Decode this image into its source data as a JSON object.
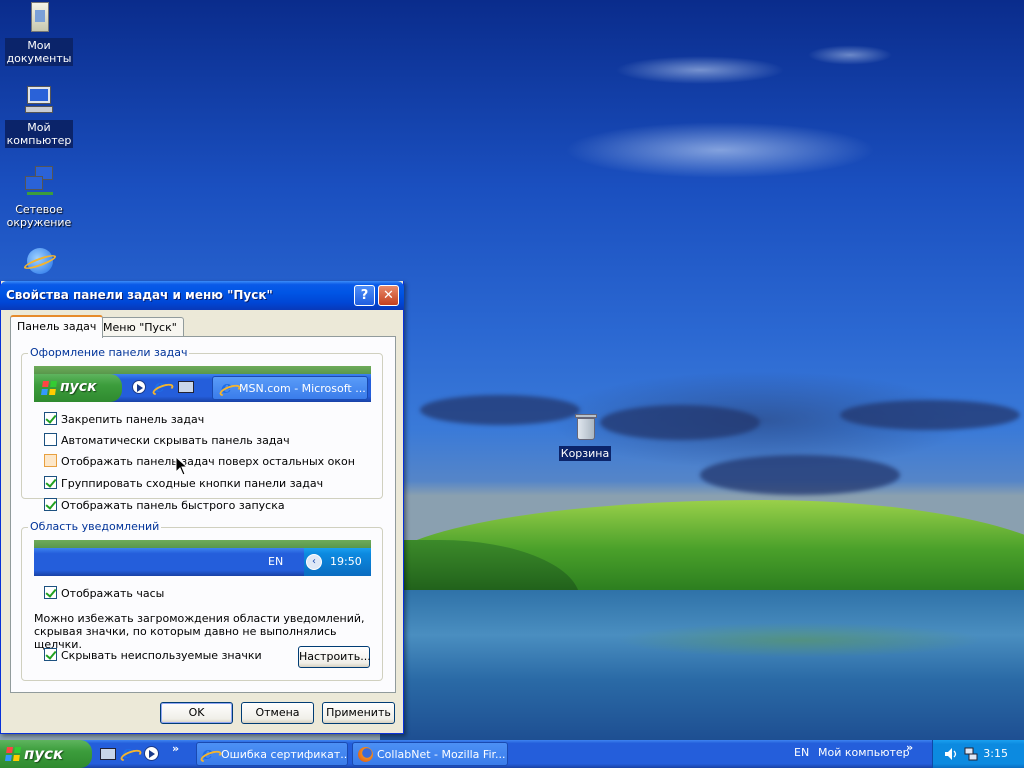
{
  "desktop": {
    "icons": [
      {
        "label_line1": "Мои",
        "label_line2": "документы",
        "icon": "my-documents-icon"
      },
      {
        "label_line1": "Мой",
        "label_line2": "компьютер",
        "icon": "my-computer-icon"
      },
      {
        "label_line1": "Сетевое",
        "label_line2": "окружение",
        "icon": "network-places-icon"
      },
      {
        "label_line1": "",
        "label_line2": "",
        "icon": "internet-explorer-icon"
      }
    ],
    "recycle_bin_label": "Корзина"
  },
  "dialog": {
    "title": "Свойства панели задач и меню \"Пуск\"",
    "help_label": "?",
    "close_label": "✕",
    "tabs": [
      {
        "label": "Панель задач",
        "active": true
      },
      {
        "label": "Меню \"Пуск\"",
        "active": false
      }
    ],
    "taskbar_group": {
      "legend": "Оформление панели задач",
      "preview_start": "пуск",
      "preview_window": "MSN.com - Microsoft ...",
      "options": [
        {
          "label": "Закрепить панель задач",
          "checked": true
        },
        {
          "label": "Автоматически скрывать панель задач",
          "checked": false
        },
        {
          "label": "Отображать панель задач поверх остальных окон",
          "checked": false
        },
        {
          "label": "Группировать сходные кнопки панели задач",
          "checked": true
        },
        {
          "label": "Отображать панель быстрого запуска",
          "checked": true
        }
      ]
    },
    "notify_group": {
      "legend": "Область уведомлений",
      "preview_lang": "EN",
      "preview_time": "19:50",
      "show_clock": {
        "label": "Отображать часы",
        "checked": true
      },
      "description": "Можно избежать загромождения области уведомлений, скрывая значки, по которым давно не выполнялись щелчки.",
      "hide_icons": {
        "label": "Скрывать неиспользуемые значки",
        "checked": true
      },
      "customize_label": "Настроить..."
    },
    "buttons": {
      "ok": "OK",
      "cancel": "Отмена",
      "apply": "Применить"
    }
  },
  "taskbar": {
    "start_label": "пуск",
    "overflow": "»",
    "tasks": [
      {
        "label": "Ошибка сертификат...",
        "icon": "ie-icon"
      },
      {
        "label": "CollabNet - Mozilla Fir...",
        "icon": "firefox-icon"
      }
    ],
    "lang": "EN",
    "toolbar_label": "Мой компьютер",
    "toolbar_overflow": "»",
    "clock": "3:15"
  },
  "colors": {
    "accent": "#0055e5",
    "start_green": "#3c9d3c",
    "dialog_bg": "#ece9d8"
  }
}
